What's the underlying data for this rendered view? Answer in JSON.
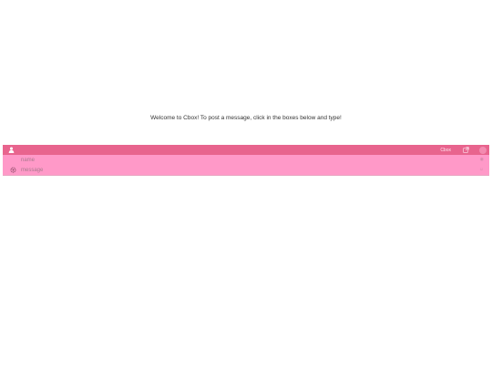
{
  "welcome_text": "Welcome to Cbox! To post a message, click in the boxes below and type!",
  "cbox": {
    "link_label": "Cbox",
    "name_field": {
      "value": "",
      "placeholder": "name"
    },
    "message_field": {
      "value": "",
      "placeholder": "message"
    }
  },
  "icons": {
    "user": "user-icon",
    "popout": "external-link-icon",
    "settings": "gear-icon",
    "name_end": "eye-icon",
    "message_end": "smile-icon",
    "bar_circle": "circle-button"
  },
  "colors": {
    "bar": "#e8648e",
    "panel": "#ff99c8",
    "text": "#333333"
  }
}
